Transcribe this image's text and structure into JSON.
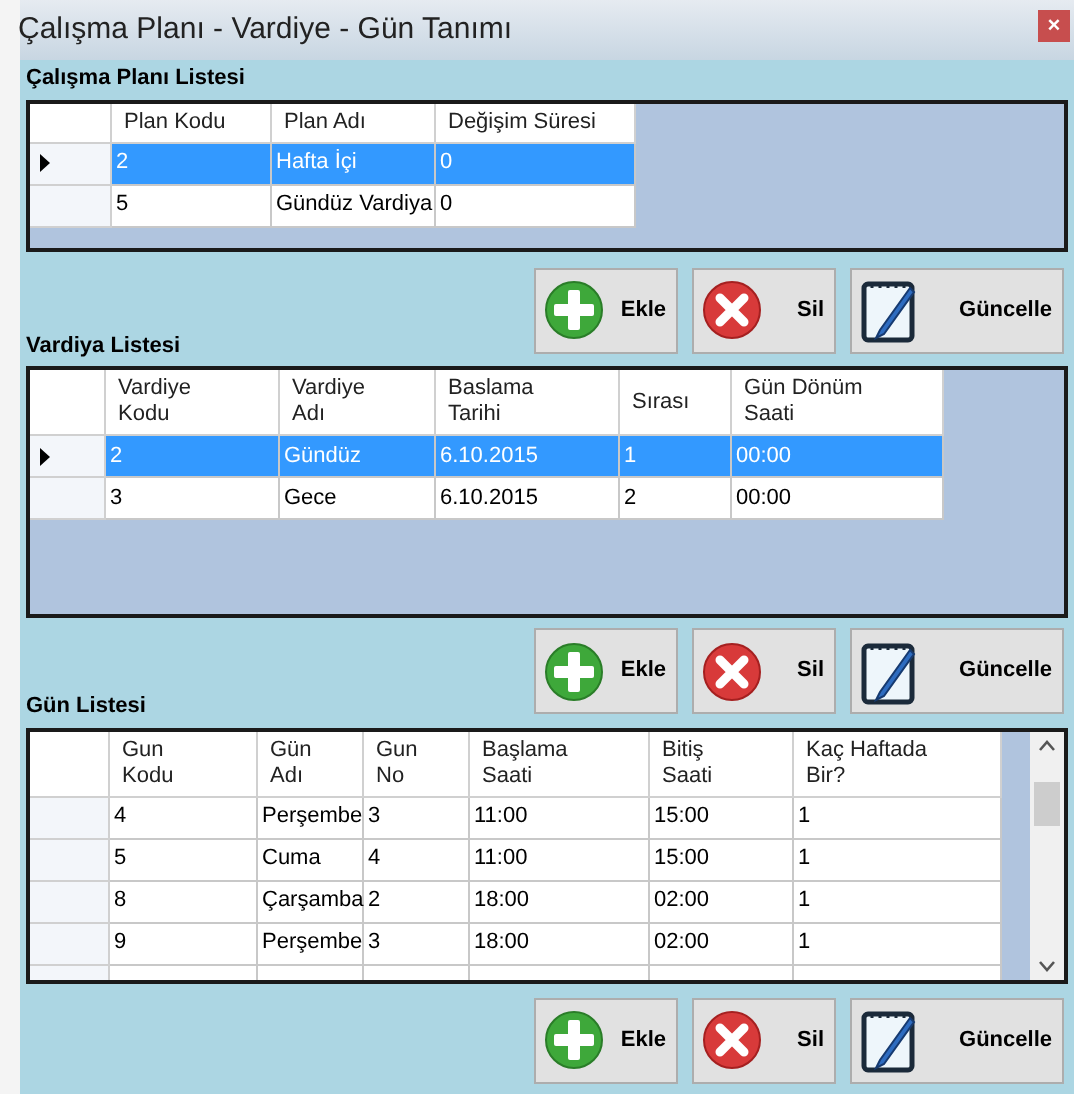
{
  "window": {
    "title": "Çalışma Planı - Vardiye - Gün Tanımı",
    "close": "×"
  },
  "sections": [
    {
      "title": "Çalışma Planı Listesi",
      "columns": [
        "Plan Kodu",
        "Plan Adı",
        "Değişim Süresi"
      ],
      "rows": [
        {
          "selected": true,
          "cells": [
            "2",
            "Hafta İçi",
            "0"
          ]
        },
        {
          "selected": false,
          "cells": [
            "5",
            "Gündüz Vardiya",
            "0"
          ]
        }
      ],
      "buttons": [
        {
          "kind": "add",
          "label": "Ekle"
        },
        {
          "kind": "delete",
          "label": "Sil"
        },
        {
          "kind": "edit",
          "label": "Güncelle"
        }
      ]
    },
    {
      "title": "Vardiya Listesi",
      "columns": [
        "Vardiye\nKodu",
        "Vardiye\nAdı",
        "Baslama\nTarihi",
        "Sırası",
        "Gün Dönüm\nSaati"
      ],
      "rows": [
        {
          "selected": true,
          "cells": [
            "2",
            "Gündüz",
            "6.10.2015",
            "1",
            "00:00"
          ]
        },
        {
          "selected": false,
          "cells": [
            "3",
            "Gece",
            "6.10.2015",
            "2",
            "00:00"
          ]
        }
      ],
      "buttons": [
        {
          "kind": "add",
          "label": "Ekle"
        },
        {
          "kind": "delete",
          "label": "Sil"
        },
        {
          "kind": "edit",
          "label": "Güncelle"
        }
      ]
    },
    {
      "title": "Gün Listesi",
      "scrollbar": true,
      "columns": [
        "Gun\nKodu",
        "Gün\nAdı",
        "Gun\nNo",
        "Başlama\nSaati",
        "Bitiş\nSaati",
        "Kaç Haftada\nBir?"
      ],
      "rows": [
        {
          "selected": false,
          "cells": [
            "4",
            "Perşembe",
            "3",
            "11:00",
            "15:00",
            "1"
          ]
        },
        {
          "selected": false,
          "cells": [
            "5",
            "Cuma",
            "4",
            "11:00",
            "15:00",
            "1"
          ]
        },
        {
          "selected": false,
          "cells": [
            "8",
            "Çarşamba",
            "2",
            "18:00",
            "02:00",
            "1"
          ]
        },
        {
          "selected": false,
          "cells": [
            "9",
            "Perşembe",
            "3",
            "18:00",
            "02:00",
            "1"
          ]
        }
      ],
      "buttons": [
        {
          "kind": "add",
          "label": "Ekle"
        },
        {
          "kind": "delete",
          "label": "Sil"
        },
        {
          "kind": "edit",
          "label": "Güncelle"
        }
      ]
    }
  ]
}
